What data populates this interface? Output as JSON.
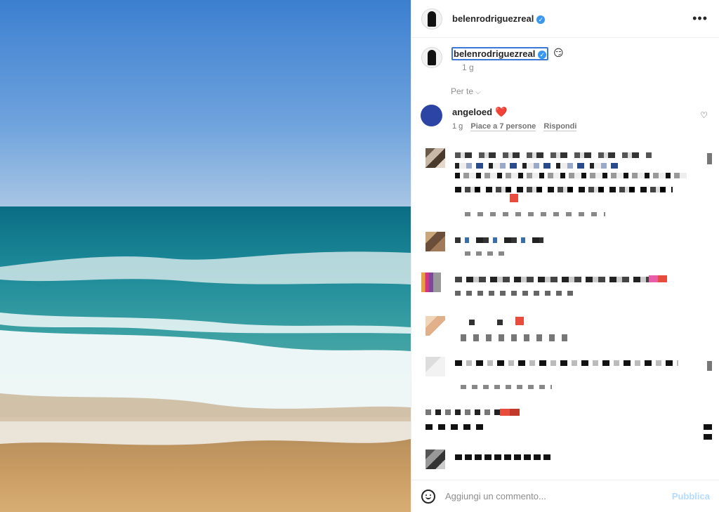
{
  "post": {
    "username": "belenrodriguezreal",
    "verified_icon": "verified-badge-icon",
    "more_icon": "more-options-icon"
  },
  "caption": {
    "username": "belenrodriguezreal",
    "emoji": "😏",
    "time": "1 g"
  },
  "sort": {
    "label": "Per te",
    "chevron": "⌵"
  },
  "comment": {
    "username": "angeloed",
    "emoji": "❤️",
    "time": "1 g",
    "likes": "Piace a 7 persone",
    "reply": "Rispondi"
  },
  "footer": {
    "placeholder": "Aggiungi un commento...",
    "publish": "Pubblica"
  },
  "colors": {
    "accent": "#3897f0",
    "publish_disabled": "#b3dbff",
    "focus_outline": "#3b78d6",
    "avatar_blue": "#2c44a4"
  }
}
